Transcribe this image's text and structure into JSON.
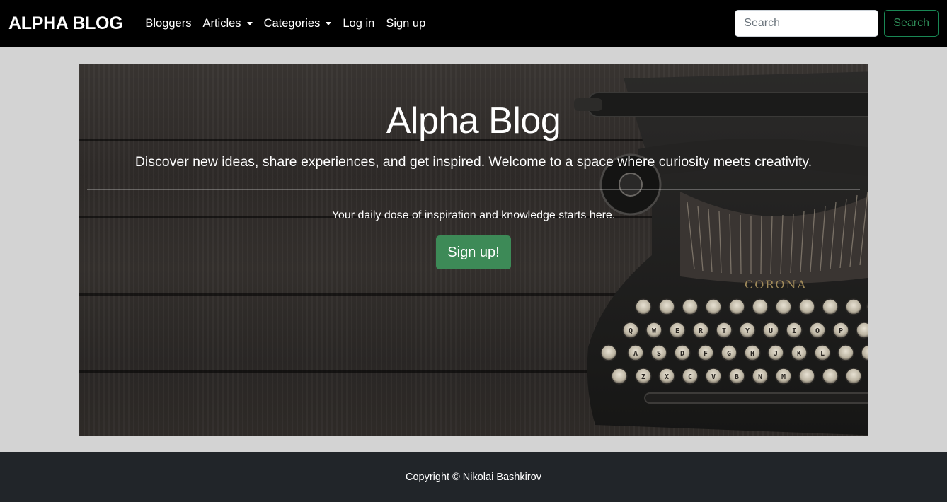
{
  "navbar": {
    "brand": "ALPHA BLOG",
    "links": [
      {
        "label": "Bloggers",
        "dropdown": false
      },
      {
        "label": "Articles",
        "dropdown": true
      },
      {
        "label": "Categories",
        "dropdown": true
      },
      {
        "label": "Log in",
        "dropdown": false
      },
      {
        "label": "Sign up",
        "dropdown": false
      }
    ],
    "search": {
      "placeholder": "Search",
      "button_label": "Search"
    }
  },
  "hero": {
    "title": "Alpha Blog",
    "lead": "Discover new ideas, share experiences, and get inspired. Welcome to a space where curiosity meets creativity.",
    "subtext": "Your daily dose of inspiration and knowledge starts here.",
    "button_label": "Sign up!",
    "image": {
      "description_icon": "typewriter-image",
      "brand_text": "CORONA"
    }
  },
  "footer": {
    "prefix": "Copyright ©",
    "author": "Nikolai Bashkirov"
  },
  "colors": {
    "navbar_bg": "#000000",
    "page_bg": "#d3d3d3",
    "success": "#198754",
    "footer_bg": "#212529"
  }
}
